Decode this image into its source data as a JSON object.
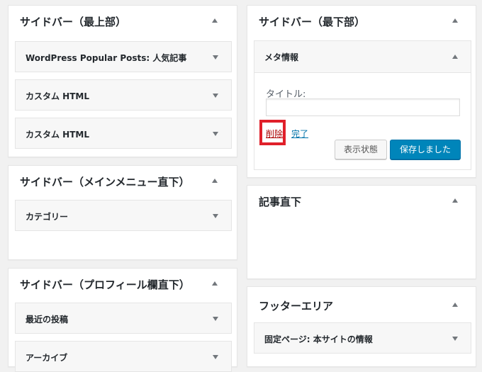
{
  "left_column": [
    {
      "title": "サイドバー（最上部）",
      "widgets": [
        "WordPress Popular Posts: 人気記事",
        "カスタム HTML",
        "カスタム HTML"
      ]
    },
    {
      "title": "サイドバー（メインメニュー直下）",
      "widgets": [
        "カテゴリー"
      ]
    },
    {
      "title": "サイドバー（プロフィール欄直下）",
      "widgets": [
        "最近の投稿",
        "アーカイブ"
      ]
    }
  ],
  "right_column": [
    {
      "title": "サイドバー（最下部）",
      "open_widget": {
        "title": "メタ情報",
        "field_label": "タイトル:",
        "field_value": "",
        "delete_label": "削除",
        "done_label": "完了",
        "visibility_button": "表示状態",
        "save_button": "保存しました"
      }
    },
    {
      "title": "記事直下",
      "widgets": []
    },
    {
      "title": "フッターエリア",
      "widgets": [
        "固定ページ: 本サイトの情報"
      ]
    }
  ],
  "colors": {
    "accent": "#0085ba",
    "delete_link": "#a00000",
    "highlight": "#e0202a",
    "background": "#f1f1f1"
  }
}
